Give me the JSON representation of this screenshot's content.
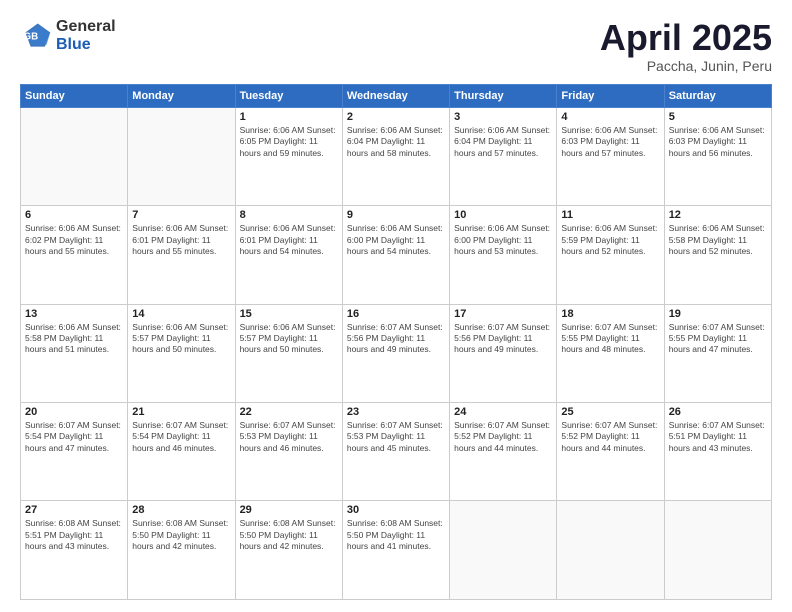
{
  "header": {
    "logo_general": "General",
    "logo_blue": "Blue",
    "month_title": "April 2025",
    "subtitle": "Paccha, Junin, Peru"
  },
  "weekdays": [
    "Sunday",
    "Monday",
    "Tuesday",
    "Wednesday",
    "Thursday",
    "Friday",
    "Saturday"
  ],
  "weeks": [
    [
      {
        "day": "",
        "info": ""
      },
      {
        "day": "",
        "info": ""
      },
      {
        "day": "1",
        "info": "Sunrise: 6:06 AM\nSunset: 6:05 PM\nDaylight: 11 hours\nand 59 minutes."
      },
      {
        "day": "2",
        "info": "Sunrise: 6:06 AM\nSunset: 6:04 PM\nDaylight: 11 hours\nand 58 minutes."
      },
      {
        "day": "3",
        "info": "Sunrise: 6:06 AM\nSunset: 6:04 PM\nDaylight: 11 hours\nand 57 minutes."
      },
      {
        "day": "4",
        "info": "Sunrise: 6:06 AM\nSunset: 6:03 PM\nDaylight: 11 hours\nand 57 minutes."
      },
      {
        "day": "5",
        "info": "Sunrise: 6:06 AM\nSunset: 6:03 PM\nDaylight: 11 hours\nand 56 minutes."
      }
    ],
    [
      {
        "day": "6",
        "info": "Sunrise: 6:06 AM\nSunset: 6:02 PM\nDaylight: 11 hours\nand 55 minutes."
      },
      {
        "day": "7",
        "info": "Sunrise: 6:06 AM\nSunset: 6:01 PM\nDaylight: 11 hours\nand 55 minutes."
      },
      {
        "day": "8",
        "info": "Sunrise: 6:06 AM\nSunset: 6:01 PM\nDaylight: 11 hours\nand 54 minutes."
      },
      {
        "day": "9",
        "info": "Sunrise: 6:06 AM\nSunset: 6:00 PM\nDaylight: 11 hours\nand 54 minutes."
      },
      {
        "day": "10",
        "info": "Sunrise: 6:06 AM\nSunset: 6:00 PM\nDaylight: 11 hours\nand 53 minutes."
      },
      {
        "day": "11",
        "info": "Sunrise: 6:06 AM\nSunset: 5:59 PM\nDaylight: 11 hours\nand 52 minutes."
      },
      {
        "day": "12",
        "info": "Sunrise: 6:06 AM\nSunset: 5:58 PM\nDaylight: 11 hours\nand 52 minutes."
      }
    ],
    [
      {
        "day": "13",
        "info": "Sunrise: 6:06 AM\nSunset: 5:58 PM\nDaylight: 11 hours\nand 51 minutes."
      },
      {
        "day": "14",
        "info": "Sunrise: 6:06 AM\nSunset: 5:57 PM\nDaylight: 11 hours\nand 50 minutes."
      },
      {
        "day": "15",
        "info": "Sunrise: 6:06 AM\nSunset: 5:57 PM\nDaylight: 11 hours\nand 50 minutes."
      },
      {
        "day": "16",
        "info": "Sunrise: 6:07 AM\nSunset: 5:56 PM\nDaylight: 11 hours\nand 49 minutes."
      },
      {
        "day": "17",
        "info": "Sunrise: 6:07 AM\nSunset: 5:56 PM\nDaylight: 11 hours\nand 49 minutes."
      },
      {
        "day": "18",
        "info": "Sunrise: 6:07 AM\nSunset: 5:55 PM\nDaylight: 11 hours\nand 48 minutes."
      },
      {
        "day": "19",
        "info": "Sunrise: 6:07 AM\nSunset: 5:55 PM\nDaylight: 11 hours\nand 47 minutes."
      }
    ],
    [
      {
        "day": "20",
        "info": "Sunrise: 6:07 AM\nSunset: 5:54 PM\nDaylight: 11 hours\nand 47 minutes."
      },
      {
        "day": "21",
        "info": "Sunrise: 6:07 AM\nSunset: 5:54 PM\nDaylight: 11 hours\nand 46 minutes."
      },
      {
        "day": "22",
        "info": "Sunrise: 6:07 AM\nSunset: 5:53 PM\nDaylight: 11 hours\nand 46 minutes."
      },
      {
        "day": "23",
        "info": "Sunrise: 6:07 AM\nSunset: 5:53 PM\nDaylight: 11 hours\nand 45 minutes."
      },
      {
        "day": "24",
        "info": "Sunrise: 6:07 AM\nSunset: 5:52 PM\nDaylight: 11 hours\nand 44 minutes."
      },
      {
        "day": "25",
        "info": "Sunrise: 6:07 AM\nSunset: 5:52 PM\nDaylight: 11 hours\nand 44 minutes."
      },
      {
        "day": "26",
        "info": "Sunrise: 6:07 AM\nSunset: 5:51 PM\nDaylight: 11 hours\nand 43 minutes."
      }
    ],
    [
      {
        "day": "27",
        "info": "Sunrise: 6:08 AM\nSunset: 5:51 PM\nDaylight: 11 hours\nand 43 minutes."
      },
      {
        "day": "28",
        "info": "Sunrise: 6:08 AM\nSunset: 5:50 PM\nDaylight: 11 hours\nand 42 minutes."
      },
      {
        "day": "29",
        "info": "Sunrise: 6:08 AM\nSunset: 5:50 PM\nDaylight: 11 hours\nand 42 minutes."
      },
      {
        "day": "30",
        "info": "Sunrise: 6:08 AM\nSunset: 5:50 PM\nDaylight: 11 hours\nand 41 minutes."
      },
      {
        "day": "",
        "info": ""
      },
      {
        "day": "",
        "info": ""
      },
      {
        "day": "",
        "info": ""
      }
    ]
  ]
}
